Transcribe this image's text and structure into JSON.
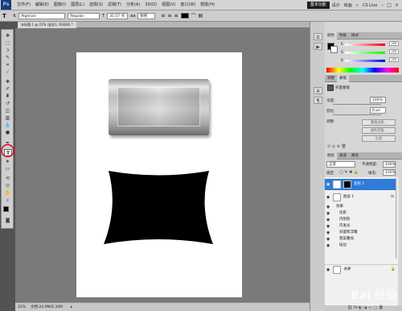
{
  "menubar": {
    "logo": "Ps",
    "items": [
      "文件(F)",
      "编辑(E)",
      "图像(I)",
      "图层(L)",
      "选择(S)",
      "滤镜(T)",
      "分析(A)",
      "3D(D)",
      "视图(V)",
      "窗口(W)",
      "帮助(H)"
    ],
    "workspace": "基本功能",
    "design": "设计",
    "paint": "绘画",
    "more": "»",
    "cslive": "CS Live"
  },
  "options": {
    "tool": "T",
    "font_family": "Algerian",
    "font_style": "Regular",
    "font_size": "35.57 点",
    "antialias": "aa",
    "aa_mode": "锐利",
    "color": "#000000"
  },
  "doc_tab": {
    "title": "未标题-1 @ 22% (变形1, RGB/8) *"
  },
  "status": {
    "zoom": "22%",
    "doc": "文档:24.9M/6.30M"
  },
  "color_panel": {
    "tabs": [
      "颜色",
      "色板",
      "样式"
    ],
    "r_label": "R",
    "g_label": "G",
    "b_label": "B",
    "r": "255",
    "g": "255",
    "b": "255"
  },
  "adjust_panel": {
    "tabs": [
      "调整",
      "蒙版"
    ],
    "title": "矢量蒙版",
    "density_label": "浓度:",
    "density": "100%",
    "feather_label": "羽化:",
    "feather": "0 px",
    "refine_label": "调整:",
    "btn_edge": "蒙版边缘...",
    "btn_range": "颜色范围...",
    "btn_invert": "反相"
  },
  "layers_panel": {
    "tabs": [
      "图层",
      "通道",
      "路径"
    ],
    "blend": "正常",
    "opacity_label": "不透明度:",
    "opacity": "100%",
    "lock_label": "锁定:",
    "fill_label": "填充:",
    "fill": "100%",
    "layers": [
      {
        "name": "变形 1",
        "kind": "shape"
      },
      {
        "name": "图层 1",
        "kind": "pixel"
      },
      {
        "name": "效果",
        "kind": "fx"
      },
      {
        "name": "投影",
        "kind": "effect"
      },
      {
        "name": "内阴影",
        "kind": "effect"
      },
      {
        "name": "内发光",
        "kind": "effect"
      },
      {
        "name": "斜面和浮雕",
        "kind": "effect"
      },
      {
        "name": "图案叠加",
        "kind": "effect"
      },
      {
        "name": "描边",
        "kind": "effect"
      },
      {
        "name": "背景",
        "kind": "background"
      }
    ]
  },
  "watermark": {
    "text": "Bai 经验",
    "sub": "jingyan.baidu.com"
  },
  "colors": {
    "accent": "#2f7bd8",
    "highlight": "#e3001b"
  }
}
